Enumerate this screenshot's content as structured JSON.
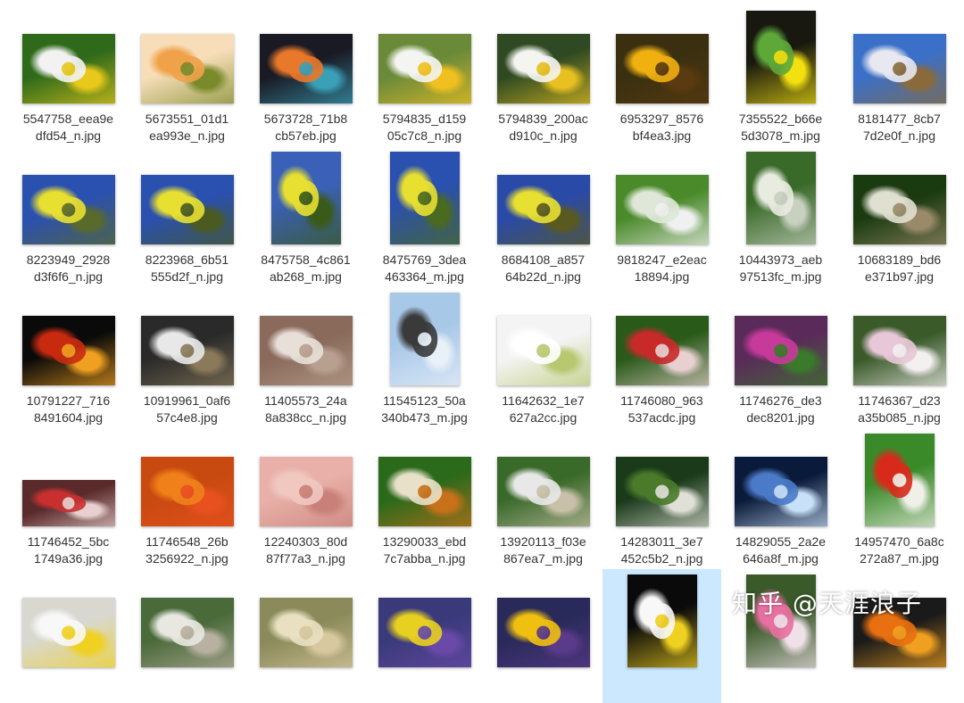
{
  "watermark": "知乎 @天涯浪子",
  "files": [
    {
      "line1": "5547758_eea9e",
      "line2": "dfd54_n.jpg",
      "orient": "land",
      "colors": [
        "#2e6a1a",
        "#f2f2f2",
        "#e8c81a"
      ]
    },
    {
      "line1": "5673551_01d1",
      "line2": "ea993e_n.jpg",
      "orient": "land",
      "colors": [
        "#f7ddb8",
        "#f0a24a",
        "#7a8a2a"
      ]
    },
    {
      "line1": "5673728_71b8",
      "line2": "cb57eb.jpg",
      "orient": "land",
      "colors": [
        "#1a1a24",
        "#e8782a",
        "#3aa0b8"
      ]
    },
    {
      "line1": "5794835_d159",
      "line2": "05c7c8_n.jpg",
      "orient": "land",
      "colors": [
        "#6a8a3a",
        "#f4f4f0",
        "#f0c020"
      ]
    },
    {
      "line1": "5794839_200ac",
      "line2": "d910c_n.jpg",
      "orient": "land",
      "colors": [
        "#2f4a22",
        "#f4f4f0",
        "#e8c020"
      ]
    },
    {
      "line1": "6953297_8576",
      "line2": "bf4ea3.jpg",
      "orient": "land",
      "colors": [
        "#3a3010",
        "#f0b010",
        "#5a3a10"
      ]
    },
    {
      "line1": "7355522_b66e",
      "line2": "5d3078_m.jpg",
      "orient": "port",
      "colors": [
        "#181810",
        "#5ea83a",
        "#f2e010"
      ]
    },
    {
      "line1": "8181477_8cb7",
      "line2": "7d2e0f_n.jpg",
      "orient": "land",
      "colors": [
        "#3a70c8",
        "#e8e8f0",
        "#8a6a3a"
      ]
    },
    {
      "line1": "8223949_2928",
      "line2": "d3f6f6_n.jpg",
      "orient": "land",
      "colors": [
        "#2a50b0",
        "#e8e030",
        "#5a6a2a"
      ]
    },
    {
      "line1": "8223968_6b51",
      "line2": "555d2f_n.jpg",
      "orient": "land",
      "colors": [
        "#2a50b0",
        "#e8e030",
        "#4a5a20"
      ]
    },
    {
      "line1": "8475758_4c861",
      "line2": "ab268_m.jpg",
      "orient": "port",
      "colors": [
        "#3a60b8",
        "#e8e030",
        "#3a5a1a"
      ]
    },
    {
      "line1": "8475769_3dea",
      "line2": "463364_m.jpg",
      "orient": "port",
      "colors": [
        "#2a50b0",
        "#e8e030",
        "#4a6a20"
      ]
    },
    {
      "line1": "8684108_a857",
      "line2": "64b22d_n.jpg",
      "orient": "land",
      "colors": [
        "#2a4aa8",
        "#e8e030",
        "#5a5a20"
      ]
    },
    {
      "line1": "9818247_e2eac",
      "line2": "18894.jpg",
      "orient": "land",
      "colors": [
        "#4a8a2a",
        "#dfe8d8",
        "#f0f0f0"
      ]
    },
    {
      "line1": "10443973_aeb",
      "line2": "97513fc_m.jpg",
      "orient": "port",
      "colors": [
        "#3a6a2a",
        "#e8ece0",
        "#c8d0c0"
      ]
    },
    {
      "line1": "10683189_bd6",
      "line2": "e371b97.jpg",
      "orient": "land",
      "colors": [
        "#1a3a10",
        "#e0e0d0",
        "#9a8a6a"
      ]
    },
    {
      "line1": "10791227_716",
      "line2": "8491604.jpg",
      "orient": "land",
      "colors": [
        "#0a0a0a",
        "#c82a10",
        "#f0a020"
      ]
    },
    {
      "line1": "10919961_0af6",
      "line2": "57c4e8.jpg",
      "orient": "land",
      "colors": [
        "#2a2a2a",
        "#e8e8e8",
        "#8a7a5a"
      ]
    },
    {
      "line1": "11405573_24a",
      "line2": "8a838cc_n.jpg",
      "orient": "land",
      "colors": [
        "#8a6a5a",
        "#e8e0d8",
        "#b8a090"
      ]
    },
    {
      "line1": "11545123_50a",
      "line2": "340b473_m.jpg",
      "orient": "port",
      "colors": [
        "#a8c8e8",
        "#3a3a3a",
        "#e8f0f8"
      ]
    },
    {
      "line1": "11642632_1e7",
      "line2": "627a2cc.jpg",
      "orient": "land",
      "colors": [
        "#f4f4f4",
        "#ffffff",
        "#b8c870"
      ]
    },
    {
      "line1": "11746080_963",
      "line2": "537acdc.jpg",
      "orient": "land",
      "colors": [
        "#2a5a1a",
        "#c82a2a",
        "#e8d0d0"
      ]
    },
    {
      "line1": "11746276_de3",
      "line2": "dec8201.jpg",
      "orient": "land",
      "colors": [
        "#5a2a5a",
        "#c83a9a",
        "#3a7a2a"
      ]
    },
    {
      "line1": "11746367_d23",
      "line2": "a35b085_n.jpg",
      "orient": "land",
      "colors": [
        "#3a5a2a",
        "#e8c8d8",
        "#f4f0f0"
      ]
    },
    {
      "line1": "11746452_5bc",
      "line2": "1749a36.jpg",
      "orient": "wide",
      "colors": [
        "#5a2a2a",
        "#c83030",
        "#e8d0d0"
      ]
    },
    {
      "line1": "11746548_26b",
      "line2": "3256922_n.jpg",
      "orient": "land",
      "colors": [
        "#c84a10",
        "#f0801a",
        "#e85020"
      ]
    },
    {
      "line1": "12240303_80d",
      "line2": "87f77a3_n.jpg",
      "orient": "land",
      "colors": [
        "#e8b0a8",
        "#f0c8c0",
        "#c88078"
      ]
    },
    {
      "line1": "13290033_ebd",
      "line2": "7c7abba_n.jpg",
      "orient": "land",
      "colors": [
        "#2a6a1a",
        "#e8e0c8",
        "#c8701a"
      ]
    },
    {
      "line1": "13920113_f03e",
      "line2": "867ea7_m.jpg",
      "orient": "land",
      "colors": [
        "#3a6a2a",
        "#e8e8e8",
        "#c8c0a8"
      ]
    },
    {
      "line1": "14283011_3e7",
      "line2": "452c5b2_n.jpg",
      "orient": "land",
      "colors": [
        "#1a3a1a",
        "#4a7a2a",
        "#e0e0d8"
      ]
    },
    {
      "line1": "14829055_2a2e",
      "line2": "646a8f_m.jpg",
      "orient": "land",
      "colors": [
        "#0a1a3a",
        "#4a7ac8",
        "#c8e0f8"
      ]
    },
    {
      "line1": "14957470_6a8c",
      "line2": "272a87_m.jpg",
      "orient": "port",
      "colors": [
        "#3a8a2a",
        "#d82a1a",
        "#f0f0e8"
      ]
    },
    {
      "line1": "",
      "line2": "",
      "orient": "land",
      "colors": [
        "#d8d8d0",
        "#f8f8f8",
        "#f0d020"
      ]
    },
    {
      "line1": "",
      "line2": "",
      "orient": "land",
      "colors": [
        "#4a6a3a",
        "#e8e8e0",
        "#b8b0a0"
      ]
    },
    {
      "line1": "",
      "line2": "",
      "orient": "land",
      "colors": [
        "#8a8a5a",
        "#e8e0c0",
        "#d8c8a0"
      ]
    },
    {
      "line1": "",
      "line2": "",
      "orient": "land",
      "colors": [
        "#3a3a7a",
        "#e8d020",
        "#6a4aa8"
      ]
    },
    {
      "line1": "",
      "line2": "",
      "orient": "land",
      "colors": [
        "#2a2a5a",
        "#f0c010",
        "#5a3a8a"
      ]
    },
    {
      "line1": "",
      "line2": "",
      "orient": "port",
      "selected": true,
      "colors": [
        "#0a0a0a",
        "#f8f8f8",
        "#f0d020"
      ]
    },
    {
      "line1": "",
      "line2": "",
      "orient": "port",
      "colors": [
        "#3a5a2a",
        "#e870a0",
        "#f0e0e8"
      ]
    },
    {
      "line1": "",
      "line2": "",
      "orient": "land",
      "colors": [
        "#1a1a1a",
        "#e87010",
        "#f0a020"
      ]
    }
  ]
}
